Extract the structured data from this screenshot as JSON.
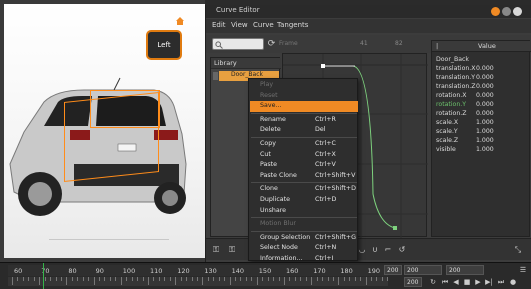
{
  "viewport": {
    "nav_cube_label": "Left"
  },
  "editor": {
    "title": "Curve Editor",
    "menus": [
      "Edit",
      "View",
      "Curve",
      "Tangents"
    ],
    "frame_label": "Frame",
    "ruler_label": "41",
    "ruler_label2": "82",
    "library_header": "Library",
    "library_item": "Door_Back",
    "props_header_value": "Value",
    "props_object": "Door_Back",
    "properties": [
      {
        "name": "translation.X",
        "value": "0.000",
        "color": "#dcdcdc"
      },
      {
        "name": "translation.Y",
        "value": "0.000",
        "color": "#dcdcdc"
      },
      {
        "name": "translation.Z",
        "value": "0.000",
        "color": "#dcdcdc"
      },
      {
        "name": "rotation.X",
        "value": "0.000",
        "color": "#dcdcdc"
      },
      {
        "name": "rotation.Y",
        "value": "0.000",
        "color": "#6cc26c"
      },
      {
        "name": "rotation.Z",
        "value": "0.000",
        "color": "#dcdcdc"
      },
      {
        "name": "scale.X",
        "value": "1.000",
        "color": "#dcdcdc"
      },
      {
        "name": "scale.Y",
        "value": "1.000",
        "color": "#dcdcdc"
      },
      {
        "name": "scale.Z",
        "value": "1.000",
        "color": "#dcdcdc"
      },
      {
        "name": "visible",
        "value": "1.000",
        "color": "#dcdcdc"
      }
    ]
  },
  "context_menu": {
    "items": [
      {
        "label": "Play",
        "shortcut": "",
        "state": "disabled"
      },
      {
        "label": "Reset",
        "shortcut": "",
        "state": "disabled"
      },
      {
        "label": "Save...",
        "shortcut": "",
        "state": "highlighted"
      },
      {
        "label": "Rename",
        "shortcut": "Ctrl+R",
        "state": "enabled"
      },
      {
        "label": "Delete",
        "shortcut": "Del",
        "state": "enabled"
      },
      {
        "label": "Copy",
        "shortcut": "Ctrl+C",
        "state": "enabled"
      },
      {
        "label": "Cut",
        "shortcut": "Ctrl+X",
        "state": "enabled"
      },
      {
        "label": "Paste",
        "shortcut": "Ctrl+V",
        "state": "enabled"
      },
      {
        "label": "Paste Clone",
        "shortcut": "Ctrl+Shift+V",
        "state": "enabled"
      },
      {
        "label": "Clone",
        "shortcut": "Ctrl+Shift+D",
        "state": "enabled"
      },
      {
        "label": "Duplicate",
        "shortcut": "Ctrl+D",
        "state": "enabled"
      },
      {
        "label": "Unshare",
        "shortcut": "",
        "state": "enabled"
      },
      {
        "label": "Motion Blur",
        "shortcut": "",
        "state": "disabled"
      },
      {
        "label": "Group Selection",
        "shortcut": "Ctrl+Shift+G",
        "state": "enabled"
      },
      {
        "label": "Select Node",
        "shortcut": "Ctrl+N",
        "state": "enabled"
      },
      {
        "label": "Information...",
        "shortcut": "Ctrl+I",
        "state": "enabled"
      }
    ]
  },
  "timeline": {
    "ticks": [
      "60",
      "70",
      "80",
      "90",
      "100",
      "110",
      "120",
      "130",
      "140",
      "150",
      "160",
      "170",
      "180",
      "190"
    ],
    "field_start": "200",
    "field_a": "200",
    "field_b": "200",
    "field_c": "200",
    "playhead_color": "#36b44a"
  },
  "colors": {
    "accent": "#f08a24",
    "bounding_box": "#ff8c1a"
  }
}
